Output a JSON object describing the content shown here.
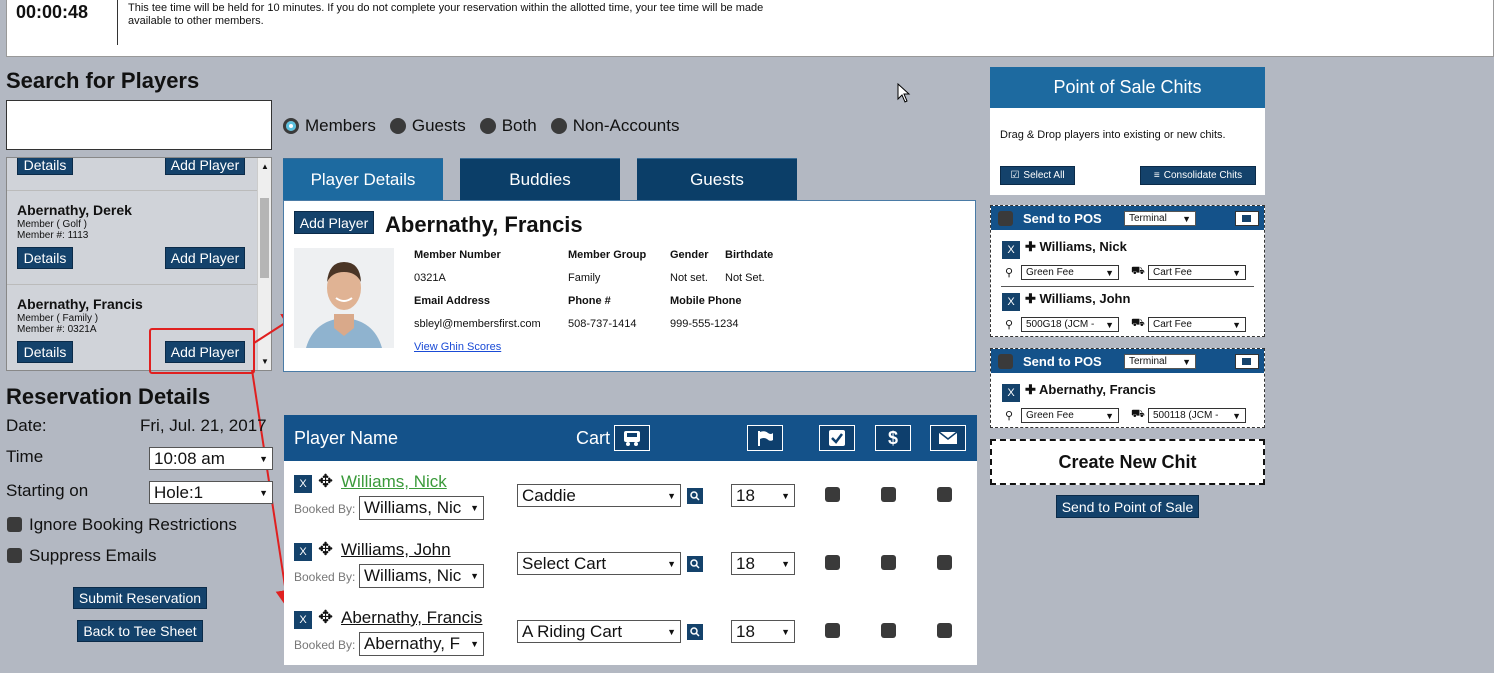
{
  "timer": {
    "countdown": "00:00:48",
    "message": "This tee time will be held for 10 minutes. If you do not complete your reservation within the allotted time, your tee time will be made available to other members."
  },
  "search": {
    "title": "Search for Players",
    "placeholder": "",
    "results": [
      {
        "name": "",
        "type": "",
        "number": "",
        "details_label": "Details",
        "add_label": "Add Player"
      },
      {
        "name": "Abernathy, Derek",
        "type": "Member ( Golf )",
        "number": "Member #: 1113",
        "details_label": "Details",
        "add_label": "Add Player"
      },
      {
        "name": "Abernathy, Francis",
        "type": "Member ( Family )",
        "number": "Member #: 0321A",
        "details_label": "Details",
        "add_label": "Add Player"
      }
    ]
  },
  "filters": {
    "options": [
      "Members",
      "Guests",
      "Both",
      "Non-Accounts"
    ],
    "selected": "Members"
  },
  "tabs": [
    "Player Details",
    "Buddies",
    "Guests"
  ],
  "player": {
    "add_label": "Add Player",
    "name": "Abernathy, Francis",
    "fields": {
      "member_number_label": "Member Number",
      "member_number": "0321A",
      "member_group_label": "Member Group",
      "member_group": "Family",
      "gender_label": "Gender",
      "gender": "Not set.",
      "birthdate_label": "Birthdate",
      "birthdate": "Not Set.",
      "email_label": "Email Address",
      "email": "sbleyl@membersfirst.com",
      "phone_label": "Phone #",
      "phone": "508-737-1414",
      "mobile_label": "Mobile Phone",
      "mobile": "999-555-1234"
    },
    "ghin_link": "View Ghin Scores"
  },
  "reservation": {
    "title": "Reservation Details",
    "date_label": "Date:",
    "date": "Fri, Jul. 21, 2017",
    "time_label": "Time",
    "time": "10:08 am",
    "start_label": "Starting on",
    "start": "Hole:1",
    "ignore_label": "Ignore Booking Restrictions",
    "suppress_label": "Suppress Emails",
    "submit_label": "Submit Reservation",
    "back_label": "Back to Tee Sheet"
  },
  "table": {
    "player_col": "Player Name",
    "cart_col": "Cart",
    "booked_by_label": "Booked By:",
    "rows": [
      {
        "name": "Williams, Nick",
        "booked_by": "Williams, Nic",
        "cart": "Caddie",
        "holes": "18"
      },
      {
        "name": "Williams, John",
        "booked_by": "Williams, Nic",
        "cart": "Select Cart",
        "holes": "18"
      },
      {
        "name": "Abernathy, Francis",
        "booked_by": "Abernathy, F",
        "cart": "A Riding Cart",
        "holes": "18"
      }
    ]
  },
  "pos": {
    "title": "Point of Sale Chits",
    "instructions": "Drag & Drop players into existing or new chits.",
    "select_all": "Select All",
    "consolidate": "Consolidate Chits",
    "send_label": "Send to POS",
    "terminal": "Terminal",
    "chits": [
      {
        "players": [
          {
            "name": "Williams, Nick",
            "fee": "Green Fee",
            "cart": "Cart Fee"
          },
          {
            "name": "Williams, John",
            "fee": "500G18 (JCM -",
            "cart": "Cart Fee"
          }
        ]
      },
      {
        "players": [
          {
            "name": "Abernathy, Francis",
            "fee": "Green Fee",
            "cart": "500118 (JCM -"
          }
        ]
      }
    ],
    "create_new": "Create New Chit",
    "send_all": "Send to Point of Sale"
  },
  "colors": {
    "navy": "#14426b",
    "accent": "#1d6aa0",
    "annotation": "#e02020",
    "link_green": "#3a9a3a"
  }
}
